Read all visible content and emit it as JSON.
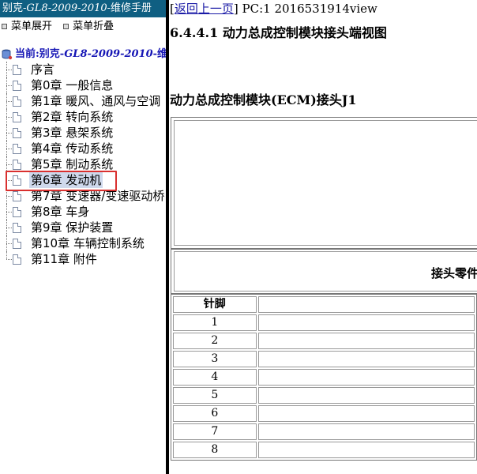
{
  "left_panel": {
    "title_prefix": "别克-",
    "title_italic": "GL8-2009-2010",
    "title_suffix": "-维修手册",
    "controls": {
      "expand_label": "菜单展开",
      "collapse_label": "菜单折叠"
    },
    "root": {
      "prefix": "当前:别克-",
      "italic": "GL8-2009-2010",
      "suffix": "-维修手"
    },
    "tree_items": [
      {
        "label": "序言"
      },
      {
        "label": "第0章 一般信息"
      },
      {
        "label": "第1章 暖风、通风与空调"
      },
      {
        "label": "第2章 转向系统"
      },
      {
        "label": "第3章 悬架系统"
      },
      {
        "label": "第4章 传动系统"
      },
      {
        "label": "第5章 制动系统"
      },
      {
        "label": "第6章 发动机",
        "selected": true
      },
      {
        "label": "第7章 变速器/变速驱动桥"
      },
      {
        "label": "第8章 车身"
      },
      {
        "label": "第9章 保护装置"
      },
      {
        "label": "第10章 车辆控制系统"
      },
      {
        "label": "第11章 附件"
      }
    ],
    "highlight_color": "#d9302f",
    "header_color": "#0f5f82"
  },
  "right_panel": {
    "back_link": "返回上一页",
    "bracket_open": "[",
    "bracket_close": "]",
    "doc_info": " PC:1 2016531914view",
    "section_title": "6.4.4.1 动力总成控制模块接头端视图",
    "connector_title": "动力总成控制模块(ECM)接头J1",
    "parts_label": "接头零件",
    "pin_table": {
      "header": "针脚",
      "pins": [
        "1",
        "2",
        "3",
        "4",
        "5",
        "6",
        "7",
        "8"
      ]
    }
  }
}
